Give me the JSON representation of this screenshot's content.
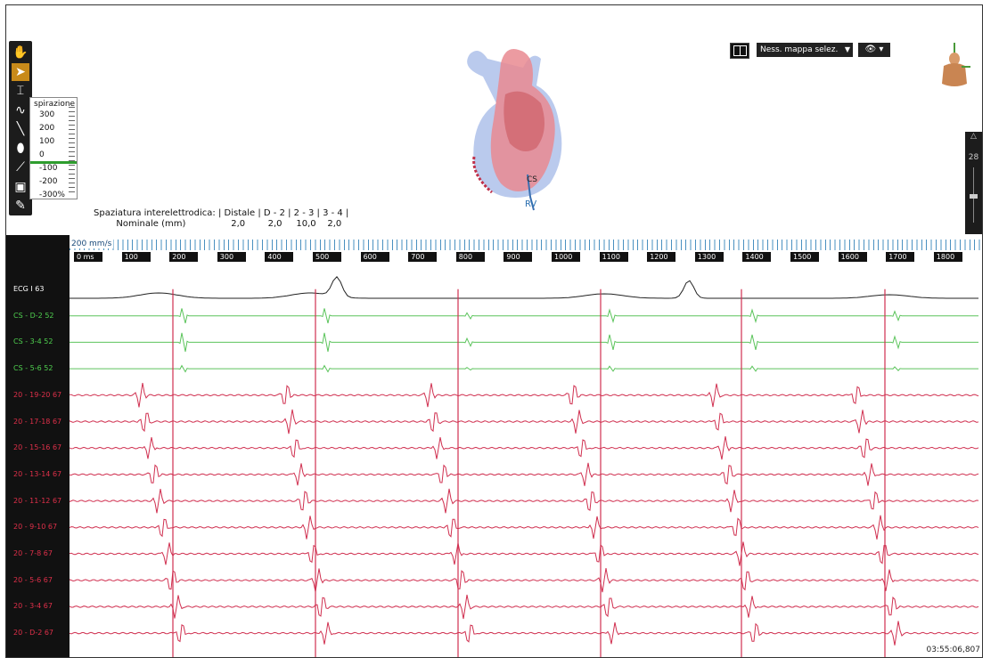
{
  "toolbar": {
    "tools": [
      {
        "name": "hand-tool-icon",
        "glyph": "✋",
        "active": false
      },
      {
        "name": "pointer-tool-icon",
        "glyph": "➤",
        "active": true
      },
      {
        "name": "caliper-tool-icon",
        "glyph": "⌶",
        "active": false
      },
      {
        "name": "curve-tool-icon",
        "glyph": "∿",
        "active": false
      },
      {
        "name": "ablation-tool-icon",
        "glyph": "╲",
        "active": false
      },
      {
        "name": "ellipse-tool-icon",
        "glyph": "⬮",
        "active": false
      },
      {
        "name": "catheter-tool-icon",
        "glyph": "⟋",
        "active": false
      },
      {
        "name": "layer-tool-icon",
        "glyph": "▣",
        "active": false
      },
      {
        "name": "pen-tool-icon",
        "glyph": "✎",
        "active": false
      }
    ]
  },
  "respiration": {
    "title": "spirazione",
    "rows": [
      "300",
      "200",
      "100",
      "0",
      "-100",
      "-200",
      "-300%"
    ]
  },
  "spacing": {
    "line1": "Spaziatura interelettrodica: | Distale | D - 2 | 2 - 3 | 3 - 4 |",
    "line2": "        Nominale (mm)                2,0        2,0     10,0    2,0"
  },
  "map_controls": {
    "map_select": "Ness. mappa selez.",
    "eye_icon": "eye-icon"
  },
  "heart": {
    "cs_label": "CS",
    "rv_label": "RV"
  },
  "vscale": {
    "value": "28"
  },
  "ruler": {
    "speed": "200 mm/s",
    "ticks": [
      "0 ms",
      "100",
      "200",
      "300",
      "400",
      "500",
      "600",
      "700",
      "800",
      "900",
      "1000",
      "1100",
      "1200",
      "1300",
      "1400",
      "1500",
      "1600",
      "1700",
      "1800"
    ]
  },
  "traces": [
    {
      "label": "ECG I 63",
      "color": "#ffffff"
    },
    {
      "label": "CS - D-2 52",
      "color": "#4fd04f"
    },
    {
      "label": "CS - 3-4 52",
      "color": "#4fd04f"
    },
    {
      "label": "CS - 5-6 52",
      "color": "#4fd04f"
    },
    {
      "label": "20 - 19-20 67",
      "color": "#e0304a"
    },
    {
      "label": "20 - 17-18 67",
      "color": "#e0304a"
    },
    {
      "label": "20 - 15-16 67",
      "color": "#e0304a"
    },
    {
      "label": "20 - 13-14 67",
      "color": "#e0304a"
    },
    {
      "label": "20 - 11-12 67",
      "color": "#e0304a"
    },
    {
      "label": "20 - 9-10 67",
      "color": "#e0304a"
    },
    {
      "label": "20 - 7-8 67",
      "color": "#e0304a"
    },
    {
      "label": "20 - 5-6 67",
      "color": "#e0304a"
    },
    {
      "label": "20 - 3-4 67",
      "color": "#e0304a"
    },
    {
      "label": "20 - D-2 67",
      "color": "#e0304a"
    }
  ],
  "timestamp": "03:55:06,807",
  "colors": {
    "ecg": "#222222",
    "cs": "#5cc45c",
    "halo": "#d03050",
    "ruler": "#4a90c0"
  }
}
